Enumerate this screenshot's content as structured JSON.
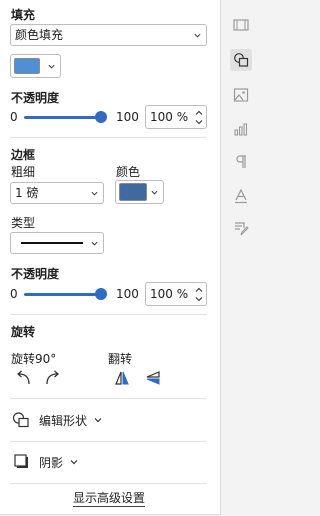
{
  "fill": {
    "heading": "填充",
    "type_value": "颜色填充",
    "color": "#4f8fd6",
    "opacity_heading": "不透明度",
    "opacity_min": "0",
    "opacity_max": "100",
    "opacity_value": "100 %",
    "opacity_fraction": 1.0
  },
  "border": {
    "heading": "边框",
    "weight_label": "粗细",
    "weight_value": "1 磅",
    "color_label": "颜色",
    "color": "#3f6aa0",
    "type_label": "类型",
    "opacity_heading": "不透明度",
    "opacity_min": "0",
    "opacity_max": "100",
    "opacity_value": "100 %",
    "opacity_fraction": 1.0
  },
  "rotation": {
    "heading": "旋转",
    "rotate_label": "旋转90°",
    "flip_label": "翻转"
  },
  "edit_shape": {
    "label": "编辑形状"
  },
  "shadow": {
    "label": "阴影"
  },
  "advanced": {
    "label": "显示高级设置"
  },
  "rail": {
    "icons": [
      "slide-settings-icon",
      "shape-settings-icon",
      "image-settings-icon",
      "chart-settings-icon",
      "paragraph-settings-icon",
      "text-art-settings-icon",
      "signature-settings-icon"
    ],
    "active": "shape-settings-icon"
  },
  "colors": {
    "accent": "#2f6cc1",
    "panel_bg": "#ffffff",
    "rail_bg": "#f3f3f3"
  }
}
